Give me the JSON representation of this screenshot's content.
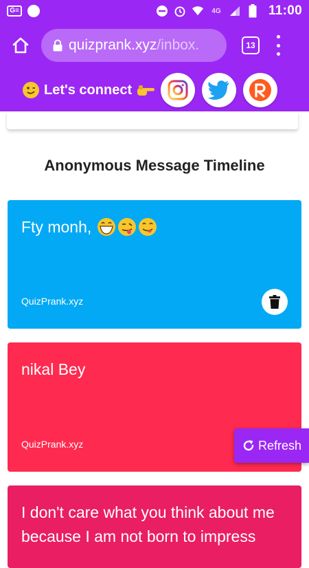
{
  "status_bar": {
    "carrier_badge": "G≡",
    "time": "11:00",
    "network": "4G"
  },
  "browser": {
    "url_host": "quizprank.xyz",
    "url_path": "/inbox.",
    "tab_count": "13"
  },
  "connect": {
    "label": "Let's connect",
    "socials": [
      "instagram",
      "twitter",
      "reddit-like R"
    ]
  },
  "timeline": {
    "title": "Anonymous Message Timeline"
  },
  "messages": [
    {
      "text": "Fty monh,",
      "source": "QuizPrank.xyz",
      "color": "#03a9f4"
    },
    {
      "text": "nikal Bey",
      "source": "QuizPrank.xyz",
      "color": "#ff2a4f"
    },
    {
      "text": "I don't care what you think about me because I am not born to impress",
      "source": "",
      "color": "#e91e63"
    }
  ],
  "refresh": {
    "label": "Refresh"
  },
  "colors": {
    "accent": "#9b27f5",
    "card_blue": "#03a9f4",
    "card_red": "#ff2a4f",
    "card_pink": "#e91e63"
  }
}
